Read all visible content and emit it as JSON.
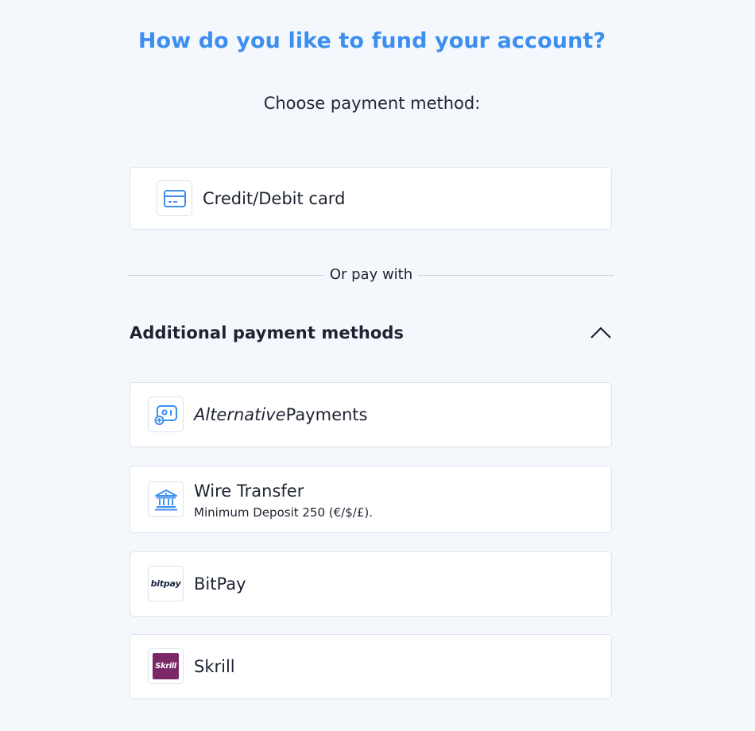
{
  "header": {
    "title": "How do you like to fund your account?",
    "subtitle": "Choose payment method:"
  },
  "primary_method": {
    "label": "Credit/Debit card",
    "icon": "credit-card-icon"
  },
  "divider": {
    "text": "Or pay with"
  },
  "additional": {
    "title": "Additional payment methods",
    "expanded": true,
    "toggle_icon": "chevron-up-icon",
    "methods": [
      {
        "label_italic": "Alternative",
        "label_rest": "Payments",
        "icon": "alternative-payments-icon"
      },
      {
        "label": "Wire Transfer",
        "sublabel": "Minimum Deposit 250 (€/$/£).",
        "icon": "bank-icon"
      },
      {
        "label": "BitPay",
        "logo_text": "bitpay",
        "icon": "bitpay-logo"
      },
      {
        "label": "Skrill",
        "logo_text": "Skrill",
        "icon": "skrill-logo",
        "logo_color": "#7b2868"
      }
    ]
  },
  "colors": {
    "accent": "#3d8fef",
    "background": "#f4f8fc",
    "card_border": "#dbe3ec"
  }
}
